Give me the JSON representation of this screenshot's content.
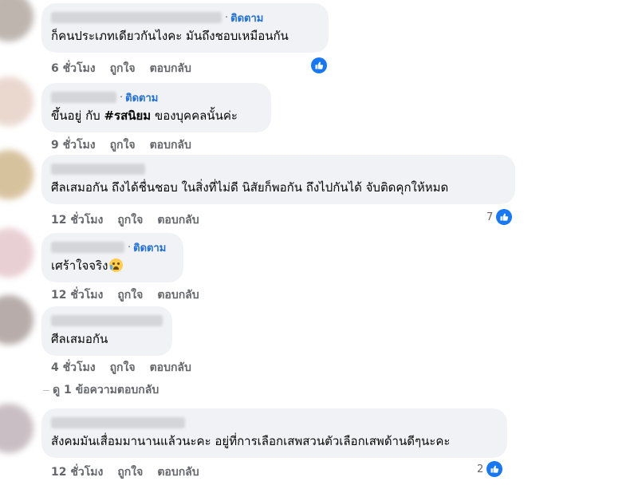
{
  "common": {
    "follow": "ติดตาม",
    "like": "ถูกใจ",
    "reply": "ตอบกลับ"
  },
  "comments": [
    {
      "text": "ก็คนประเภทเดียวกันไงคะ มันถึงชอบเหมือนกัน",
      "time": "6 ชั่วโมง",
      "likes": ""
    },
    {
      "text_pre": "ขึ้นอยู่ กับ ",
      "text_bold": "#รสนิยม",
      "text_post": " ของบุคคลนั้นค่ะ",
      "time": "9 ชั่วโมง"
    },
    {
      "text": "ศีลเสมอกัน ถึงได้ชื่นชอบ ในสิ่งที่ไม่ดี นิสัยก็พอกัน ถึงไปกันได้ จับติดคุกให้หมด",
      "time": "12 ชั่วโมง",
      "likes": "7"
    },
    {
      "text": "เศร้าใจจริง",
      "time": "12 ชั่วโมง"
    },
    {
      "text": "ศีลเสมอกัน",
      "time": "4 ชั่วโมง"
    },
    {
      "text": "สังคมมันเสื่อมมานานแล้วนะคะ อยู่ที่การเลือกเสพสวนตัวเลือกเสพด้านดีๆนะคะ",
      "time": "12 ชั่วโมง",
      "likes": "2"
    }
  ],
  "view_replies": "ดู 1 ข้อความตอบกลับ",
  "colors": {
    "bubble": "#f0f2f5",
    "link": "#216fdb",
    "meta": "#65676b",
    "like": "#1877f2"
  },
  "icons": {
    "like": "thumbs-up-icon",
    "emoji": "crying-face-emoji"
  }
}
